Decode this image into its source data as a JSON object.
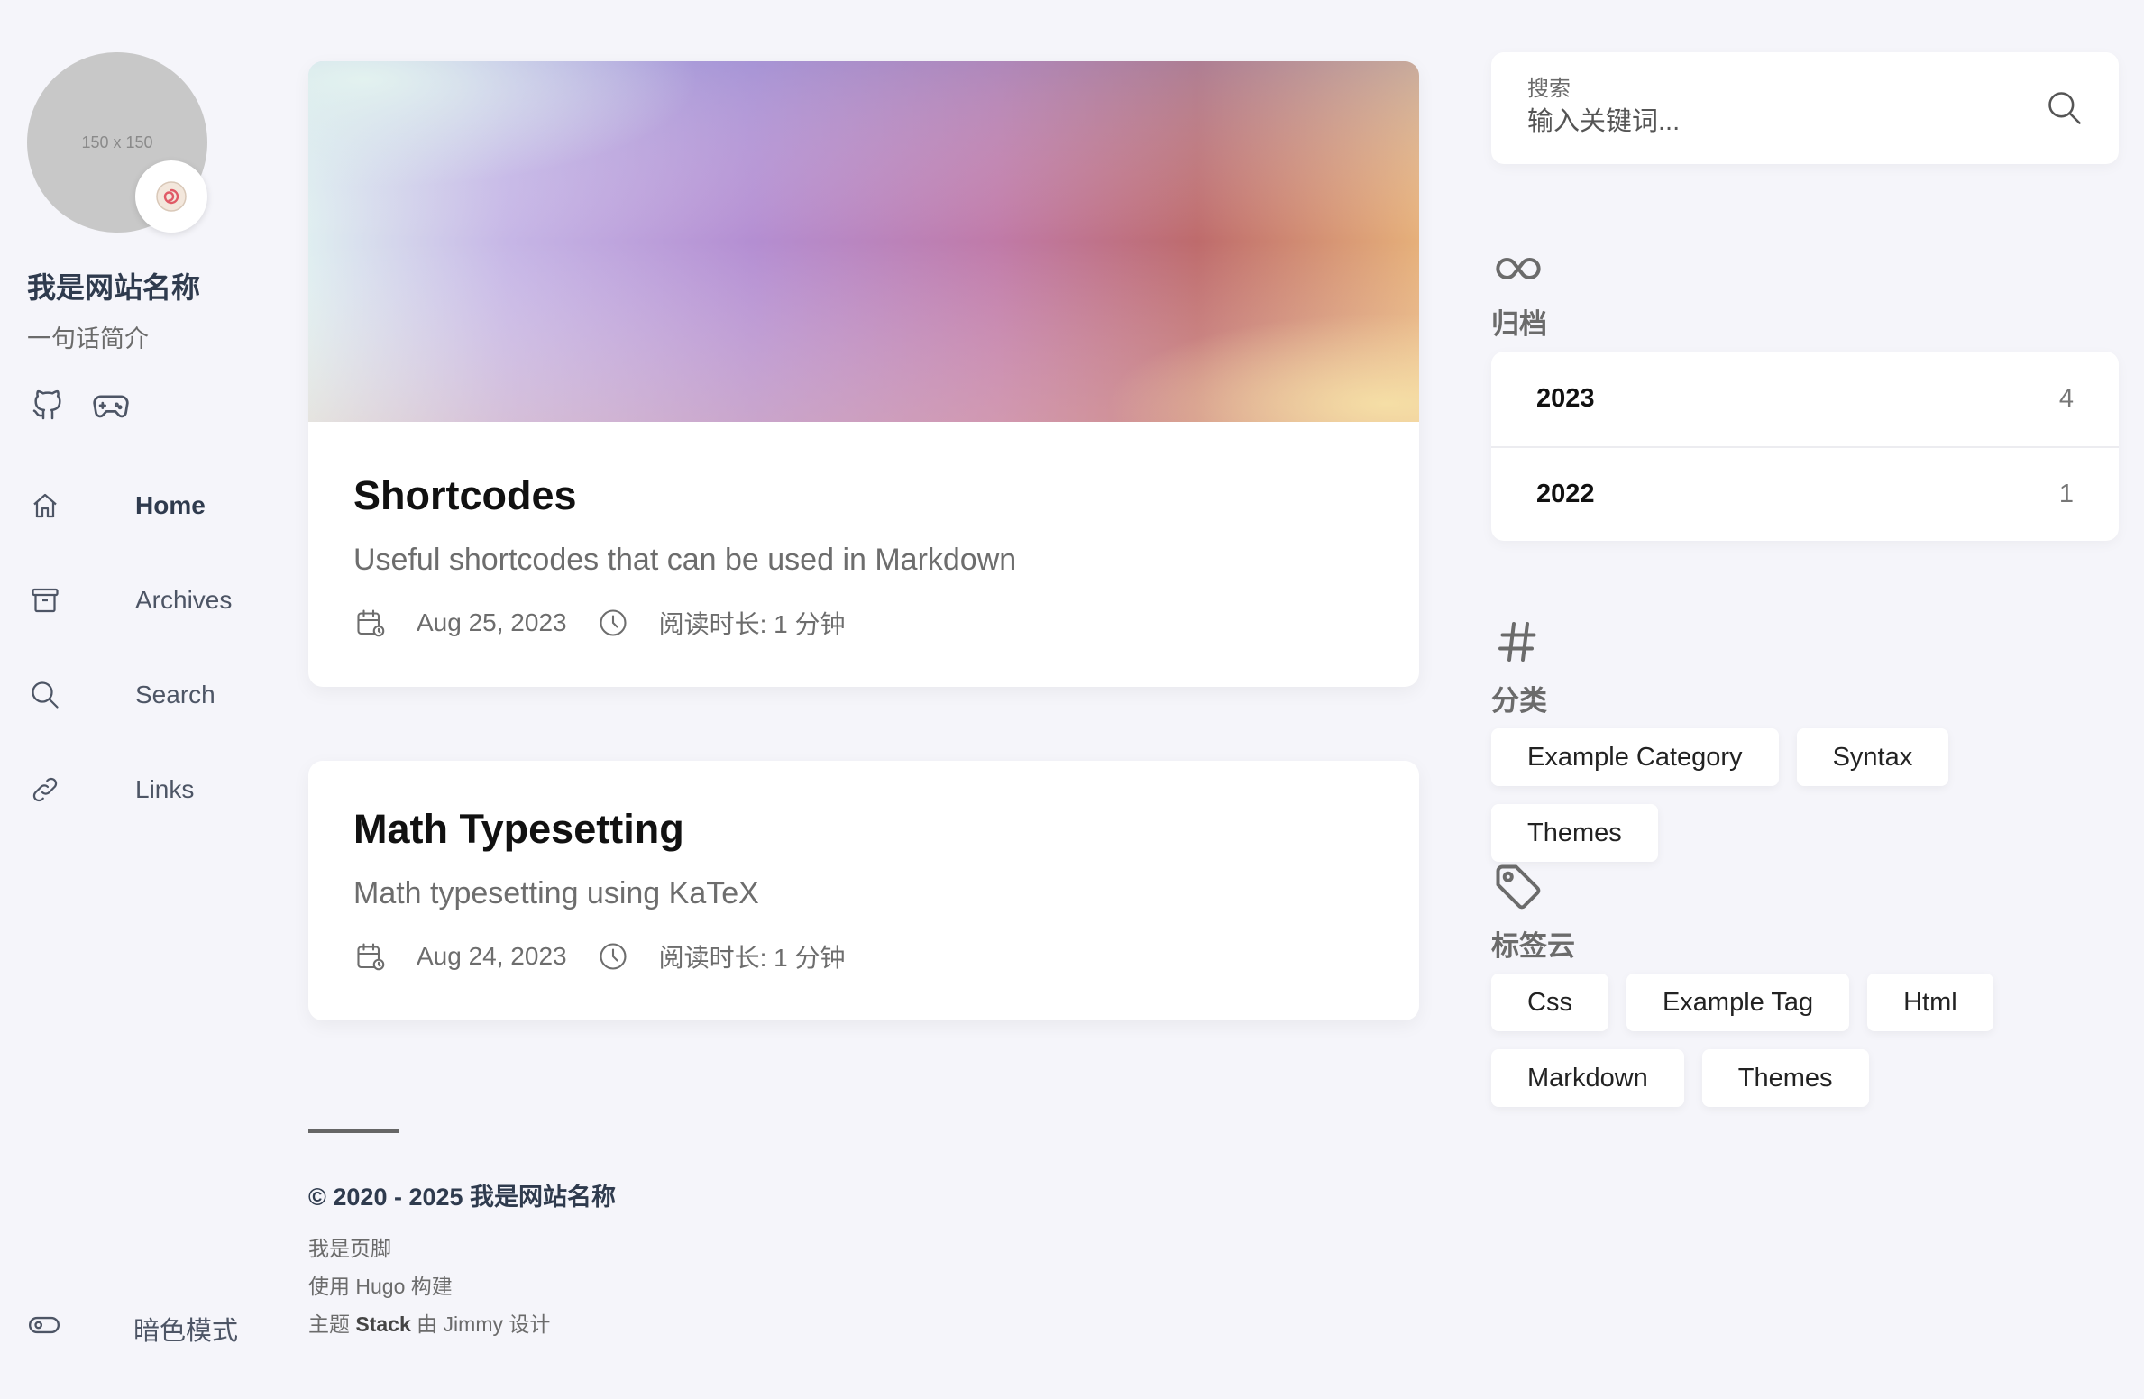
{
  "profile": {
    "avatar_placeholder": "150 x 150",
    "site_name": "我是网站名称",
    "site_desc": "一句话简介"
  },
  "social": [
    {
      "icon": "github-icon"
    },
    {
      "icon": "gamepad-icon"
    }
  ],
  "menu": [
    {
      "label": "Home",
      "icon": "home-icon",
      "active": true
    },
    {
      "label": "Archives",
      "icon": "archive-box-icon"
    },
    {
      "label": "Search",
      "icon": "search-icon"
    },
    {
      "label": "Links",
      "icon": "link-icon"
    }
  ],
  "dark_mode": {
    "label": "暗色模式"
  },
  "posts": [
    {
      "title": "Shortcodes",
      "subtitle": "Useful shortcodes that can be used in Markdown",
      "date": "Aug 25, 2023",
      "reading_time": "阅读时长: 1 分钟",
      "has_cover": true
    },
    {
      "title": "Math Typesetting",
      "subtitle": "Math typesetting using KaTeX",
      "date": "Aug 24, 2023",
      "reading_time": "阅读时长: 1 分钟",
      "has_cover": false
    }
  ],
  "footer": {
    "copyright": "© 2020 - 2025 我是网站名称",
    "line1": "我是页脚",
    "line2": "使用 Hugo 构建",
    "line3_prefix": "主题 ",
    "line3_bold": "Stack",
    "line3_suffix": " 由 Jimmy 设计"
  },
  "search": {
    "label": "搜索",
    "placeholder": "输入关键词..."
  },
  "archives": {
    "title": "归档",
    "items": [
      {
        "year": "2023",
        "count": "4"
      },
      {
        "year": "2022",
        "count": "1"
      }
    ]
  },
  "categories": {
    "title": "分类",
    "items": [
      "Example Category",
      "Syntax",
      "Themes"
    ]
  },
  "tags": {
    "title": "标签云",
    "items": [
      "Css",
      "Example Tag",
      "Html",
      "Markdown",
      "Themes"
    ]
  },
  "colors": {
    "background": "#f5f5fa",
    "text_strong": "#2f3b4e",
    "muted": "#6b6b6b"
  }
}
